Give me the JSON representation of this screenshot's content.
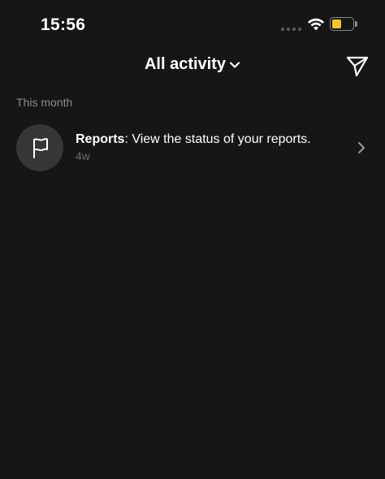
{
  "status_bar": {
    "time": "15:56",
    "signal_icon": "signal-dots-icon",
    "wifi_icon": "wifi-icon",
    "battery_icon": "battery-icon",
    "battery_color": "#f4c430"
  },
  "header": {
    "title": "All activity",
    "dropdown_icon": "chevron-down-icon",
    "send_icon": "paper-plane-icon"
  },
  "section": {
    "label": "This month"
  },
  "activities": [
    {
      "icon": "flag-icon",
      "title_bold": "Reports",
      "title_rest": ": View the status of your reports.",
      "time": "4w",
      "chevron_icon": "chevron-right-icon"
    }
  ],
  "colors": {
    "background": "#161616",
    "avatar_bg": "#363636",
    "secondary_text": "#8c8c8c"
  }
}
